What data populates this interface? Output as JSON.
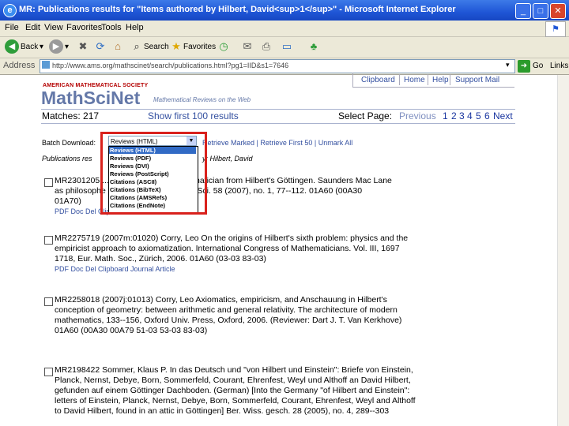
{
  "window": {
    "title": "MR: Publications results for \"Items authored by Hilbert, David<sup>1</sup>\" - Microsoft Internet Explorer",
    "minimize": "_",
    "maximize": "□",
    "close": "✕"
  },
  "menu": [
    "File",
    "Edit",
    "View",
    "Favorites",
    "Tools",
    "Help"
  ],
  "toolbar": {
    "back": "Back",
    "search": "Search",
    "favorites": "Favorites"
  },
  "address": {
    "label": "Address",
    "url": "http://www.ams.org/mathscinet/search/publications.html?pg1=IID&s1=7646",
    "go": "Go",
    "links": "Links"
  },
  "header": {
    "ams": "AMERICAN MATHEMATICAL SOCIETY",
    "logo": "MathSciNet",
    "tagline": "Mathematical Reviews on the Web",
    "links": [
      "Clipboard",
      "Home",
      "Help",
      "Support Mail"
    ]
  },
  "matches": {
    "label": "Matches: 217",
    "show_first": "Show first 100 results",
    "select_page": "Select Page:",
    "previous": "Previous",
    "pages": [
      "1",
      "2",
      "3",
      "4",
      "5",
      "6"
    ],
    "next": "Next"
  },
  "batch": {
    "label": "Batch Download:",
    "selected": "Reviews (HTML)",
    "options": [
      "Reviews (HTML)",
      "Reviews (PDF)",
      "Reviews (DVI)",
      "Reviews (PostScript)",
      "Citations (ASCII)",
      "Citations (BibTeX)",
      "Citations (AMSRefs)",
      "Citations (EndNote)"
    ],
    "actions": "Retrieve Marked | Retrieve First 50 | Unmark All",
    "pub_label": "Publications res",
    "pub_suffix": "y: Hilbert, David"
  },
  "entries": [
    {
      "lines": [
        "MR2301205 ...  ...  ... Just in the mathematician from Hilbert's Göttingen. Saunders Mac Lane",
        "as philosophe ... ... ... British J. Philos. Sci. 58 (2007), no. 1, 77--112. 01A60 (00A30",
        "01A70)"
      ],
      "links": "PDF  Doc Del  Clipboard  Journal  Article"
    },
    {
      "lines": [
        "MR2275719 (2007m:01020) Corry, Leo On the origins of Hilbert's sixth problem: physics and the",
        "empiricist approach to axiomatization. International Congress of Mathematicians. Vol. III, 1697",
        "1718, Eur. Math. Soc., Zürich, 2006. 01A60 (03-03 83-03)"
      ],
      "links": "PDF  Doc Del  Clipboard  Journal  Article"
    },
    {
      "lines": [
        "MR2258018 (2007j:01013) Corry, Leo Axiomatics, empiricism, and Anschauung in Hilbert's",
        "conception of geometry: between arithmetic and general relativity. The architecture of modern",
        "mathematics, 133--156, Oxford Univ. Press, Oxford, 2006. (Reviewer: Dart J. T. Van Kerkhove)",
        "01A60 (00A30 00A79 51-03 53-03 83-03)"
      ],
      "links": ""
    },
    {
      "lines": [
        "MR2198422 Sommer, Klaus P. In das Deutsch und \"von Hilbert und Einstein\": Briefe von Einstein,",
        "Planck, Nernst, Debye, Born, Sommerfeld, Courant, Ehrenfest, Weyl und Althoff an David Hilbert,",
        "gefunden auf einem Göttinger Dachboden. (German) [Into the Germany \"of Hilbert and Einstein\":",
        "letters of Einstein, Planck, Nernst, Debye, Born, Sommerfeld, Courant, Ehrenfest, Weyl and Althoff",
        "to David Hilbert, found in an attic in Göttingen] Ber. Wiss. gesch. 28 (2005), no. 4, 289--303"
      ],
      "links": ""
    }
  ],
  "colors": {
    "titlebar": "#1f56d6",
    "accent": "#3450a0",
    "highlight": "#316ac5",
    "redbox": "#d9211c"
  }
}
